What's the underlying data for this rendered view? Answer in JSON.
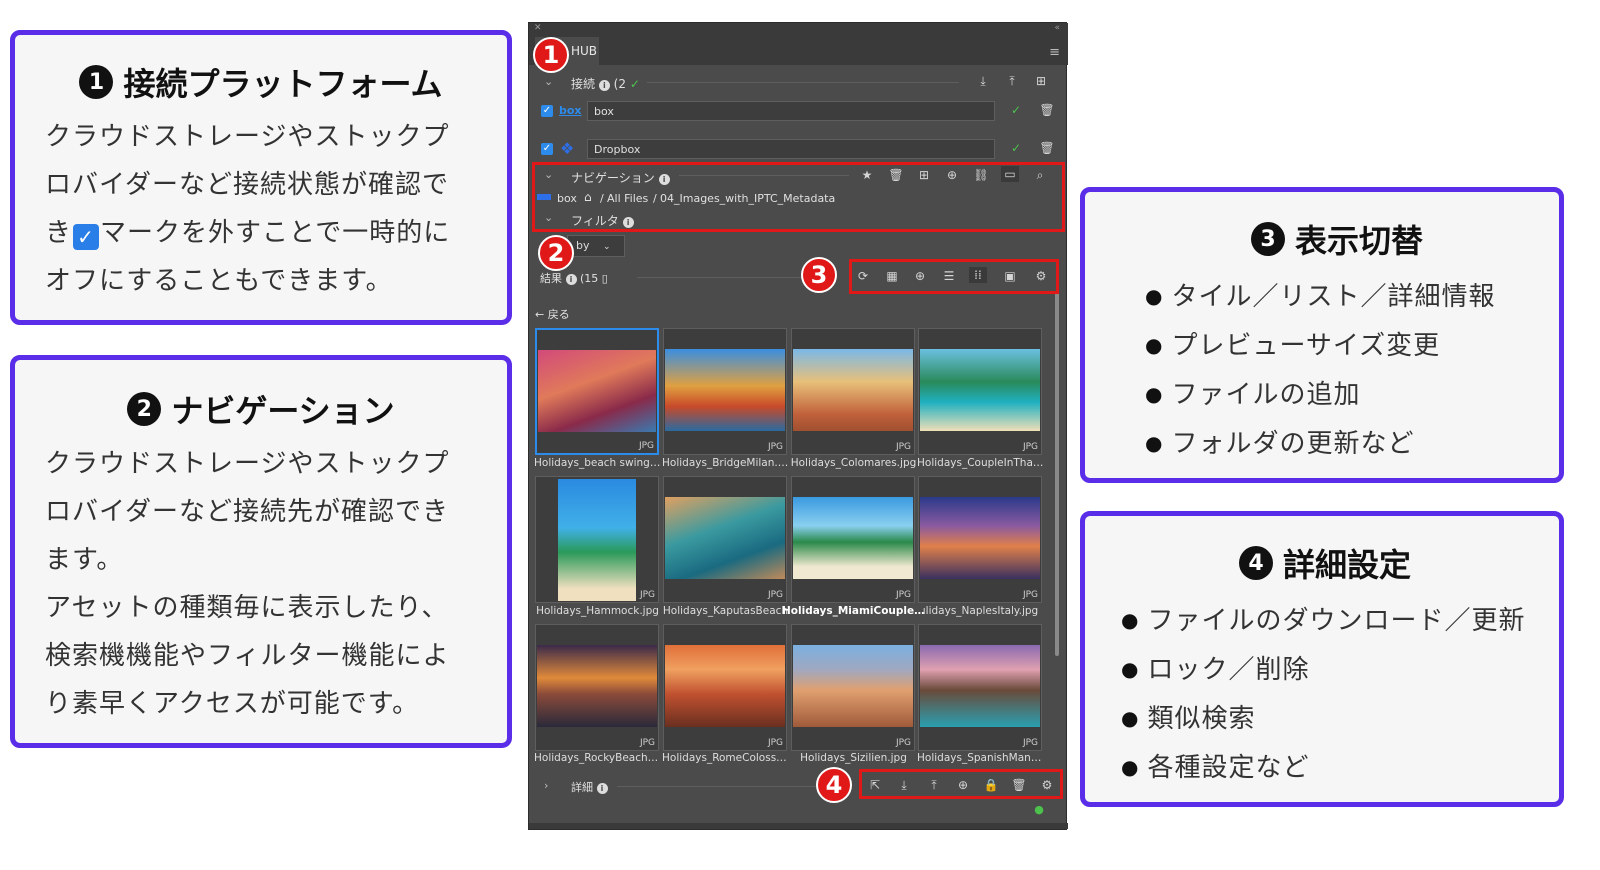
{
  "callouts": {
    "c1": {
      "num": "1",
      "title": "接続プラットフォーム",
      "line1": "クラウドストレージやストックプ",
      "line2": "ロバイダーなど接続状態が確認で",
      "line3a": "き",
      "line3b": "マークを外すことで一時的に",
      "line4": "オフにすることもできます。"
    },
    "c2": {
      "num": "2",
      "title": "ナビゲーション",
      "lines": [
        "クラウドストレージやストックプ",
        "ロバイダーなど接続先が確認でき",
        "ます。",
        "アセットの種類毎に表示したり、",
        "検索機機能やフィルター機能によ",
        "り素早くアクセスが可能です。"
      ]
    },
    "c3": {
      "num": "3",
      "title": "表示切替",
      "items": [
        "タイル／リスト／詳細情報",
        "プレビューサイズ変更",
        "ファイルの追加",
        "フォルダの更新など"
      ]
    },
    "c4": {
      "num": "4",
      "title": "詳細設定",
      "items": [
        "ファイルのダウンロード／更新",
        "ロック／削除",
        "類似検索",
        "各種設定など"
      ]
    }
  },
  "panel": {
    "tab_label": "HUB",
    "connections": {
      "label": "接続",
      "count": "(2",
      "check": "✓"
    },
    "accounts": [
      {
        "logo": "box",
        "name": "box"
      },
      {
        "logo": "dropbox",
        "name": "Dropbox"
      }
    ],
    "navigation": {
      "label": "ナビゲーション"
    },
    "breadcrumb": {
      "root": "box",
      "home": "⌂",
      "p1": "All Files",
      "p2": "04_Images_with_IPTC_Metadata"
    },
    "filter": {
      "label": "フィルタ"
    },
    "sort": {
      "label": "by"
    },
    "results": {
      "label": "結果",
      "count": "(15"
    },
    "back": "戻る",
    "files": [
      {
        "name": "Holidays_beach swing.j...",
        "type": "JPG"
      },
      {
        "name": "Holidays_BridgeMilan.jpg",
        "type": "JPG"
      },
      {
        "name": "Holidays_Colomares.jpg",
        "type": "JPG"
      },
      {
        "name": "Holidays_CoupleInThail...",
        "type": "JPG"
      },
      {
        "name": "Holidays_Hammock.jpg",
        "type": "JPG"
      },
      {
        "name": "Holidays_KaputasBeach",
        "type": "JPG"
      },
      {
        "name": "Holidays_MiamiCouple.jpg",
        "type": "JPG"
      },
      {
        "name": "ılidays_NaplesItaly.jpg",
        "type": "JPG"
      },
      {
        "name": "Holidays_RockyBeach.jpg",
        "type": "JPG"
      },
      {
        "name": "Holidays_RomeColosse...",
        "type": "JPG"
      },
      {
        "name": "Holidays_Sizilien.jpg",
        "type": "JPG"
      },
      {
        "name": "Holidays_SpanishMansi...",
        "type": "JPG"
      }
    ],
    "details": {
      "label": "詳細"
    },
    "badges": [
      "1",
      "2",
      "3",
      "4"
    ]
  }
}
